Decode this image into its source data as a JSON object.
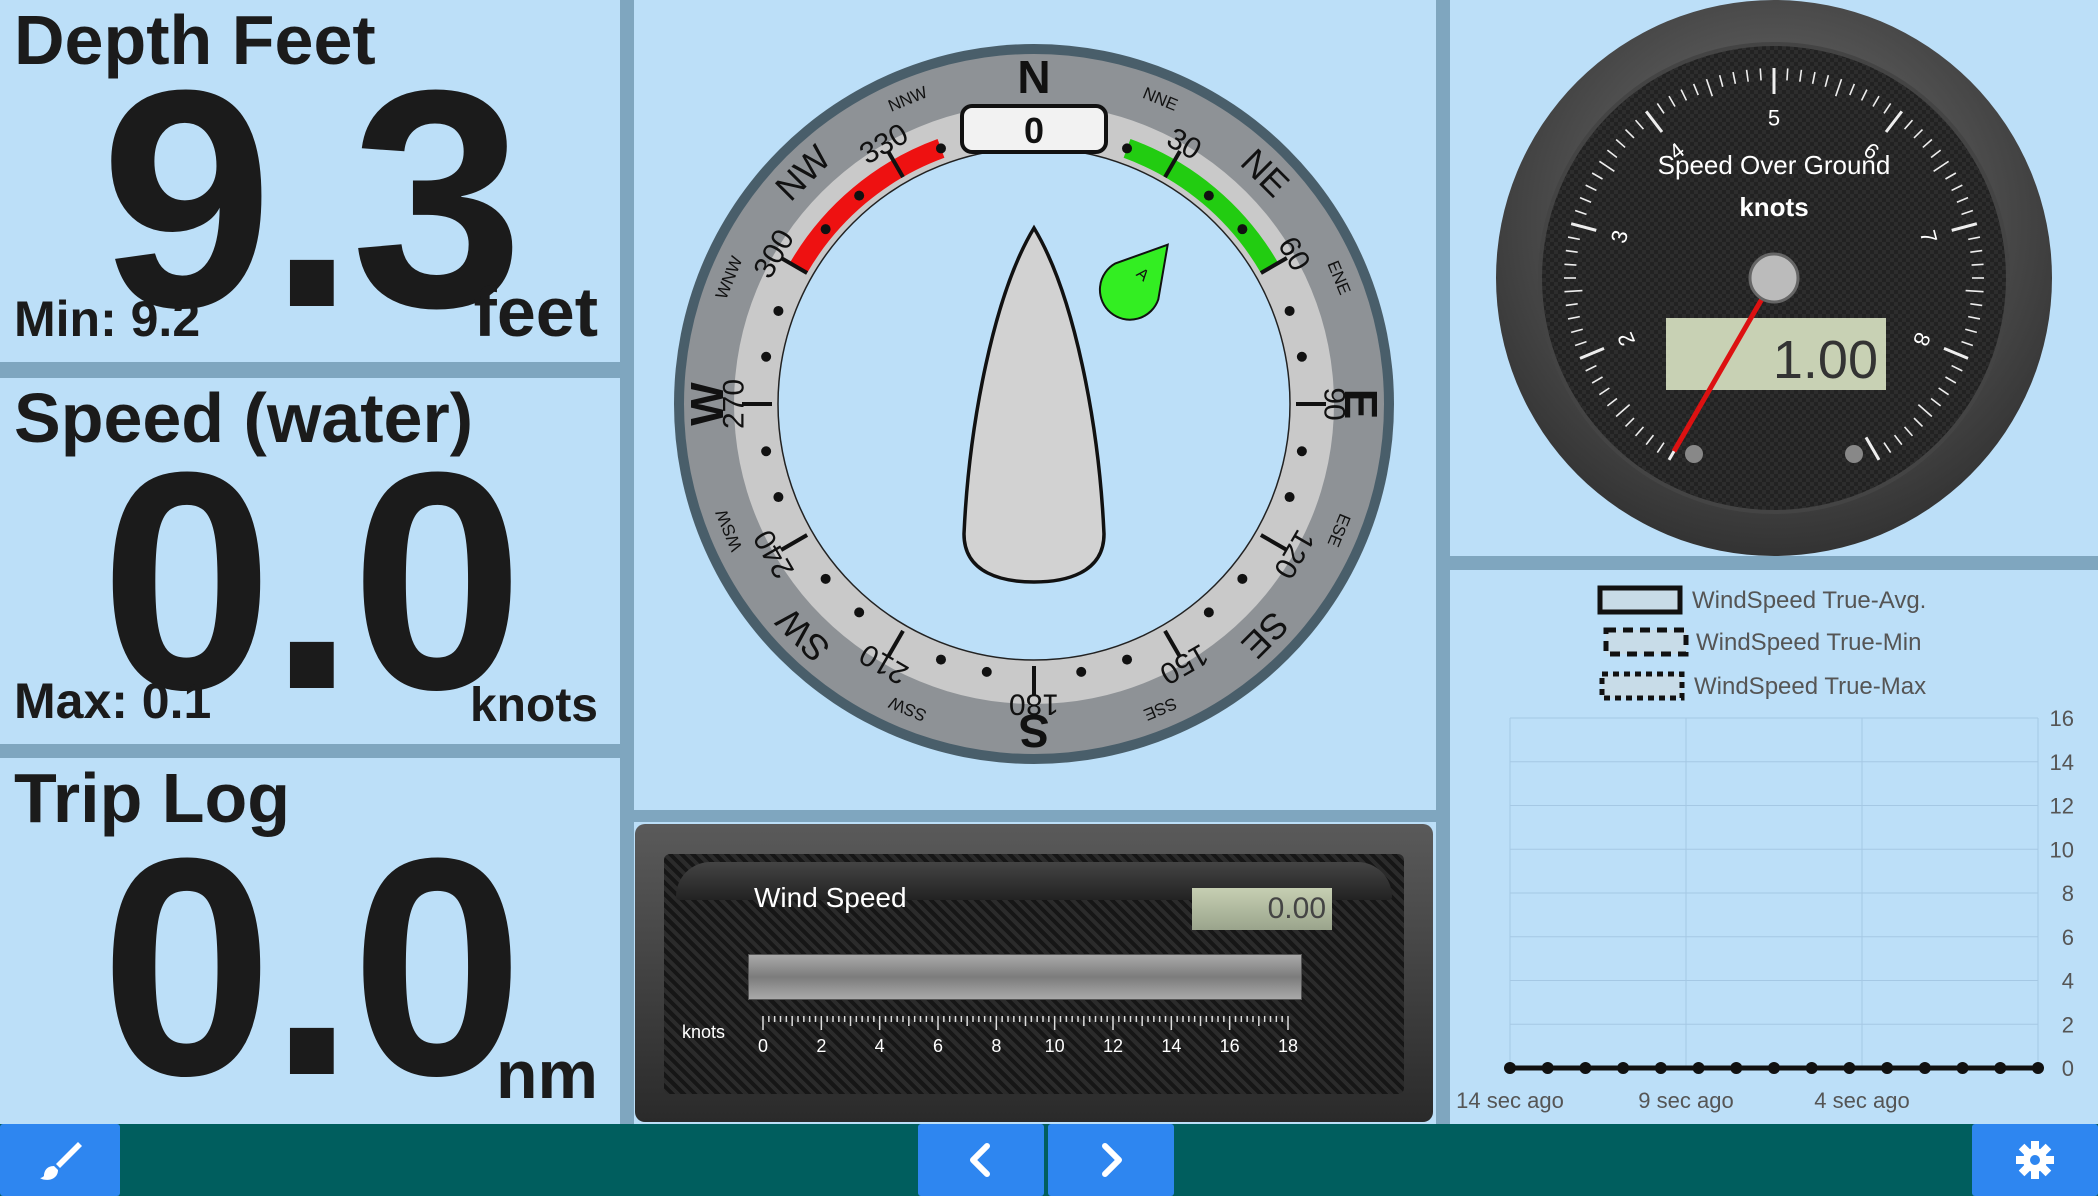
{
  "depth": {
    "title": "Depth Feet",
    "value": "9.3",
    "sub": "Min: 9.2",
    "unit": "feet"
  },
  "speed_water": {
    "title": "Speed (water)",
    "value": "0.0",
    "sub": "Max: 0.1",
    "unit": "knots"
  },
  "trip_log": {
    "title": "Trip Log",
    "value": "0.0",
    "unit": "nm"
  },
  "compass": {
    "heading": "0",
    "cardinals": {
      "n": "N",
      "e": "E",
      "s": "S",
      "w": "W"
    },
    "intercardinals": {
      "ne": "NE",
      "se": "SE",
      "sw": "SW",
      "nw": "NW"
    },
    "minor": {
      "nne": "NNE",
      "ene": "ENE",
      "ese": "ESE",
      "sse": "SSE",
      "ssw": "SSW",
      "wsw": "WSW",
      "wnw": "WNW",
      "nnw": "NNW"
    },
    "degree_labels": [
      "30",
      "60",
      "90",
      "120",
      "150",
      "180",
      "210",
      "240",
      "270",
      "300",
      "330"
    ],
    "wind_marker_label": "A",
    "colors": {
      "port": "#ee1111",
      "starboard": "#22cc11",
      "wind_marker": "#33ee22"
    }
  },
  "wind_speed": {
    "title": "Wind Speed",
    "value": "0.00",
    "unit": "knots",
    "scale": [
      "0",
      "2",
      "4",
      "6",
      "8",
      "10",
      "12",
      "14",
      "16",
      "18"
    ],
    "min": 0,
    "max": 18,
    "current": 0
  },
  "sog": {
    "title": "Speed Over Ground",
    "unit": "knots",
    "value": "1.00",
    "scale": [
      "2",
      "3",
      "4",
      "5",
      "6",
      "7",
      "8"
    ],
    "min": 1,
    "max": 9,
    "current": 1.0
  },
  "chart_data": {
    "type": "line",
    "series": [
      {
        "name": "WindSpeed True-Avg.",
        "values": [
          0,
          0,
          0,
          0,
          0,
          0,
          0,
          0,
          0,
          0,
          0,
          0,
          0,
          0,
          0
        ]
      },
      {
        "name": "WindSpeed True-Min",
        "values": [
          0,
          0,
          0,
          0,
          0,
          0,
          0,
          0,
          0,
          0,
          0,
          0,
          0,
          0,
          0
        ]
      },
      {
        "name": "WindSpeed True-Max",
        "values": [
          0,
          0,
          0,
          0,
          0,
          0,
          0,
          0,
          0,
          0,
          0,
          0,
          0,
          0,
          0
        ]
      }
    ],
    "x_labels": [
      "14 sec ago",
      "9 sec ago",
      "4 sec ago"
    ],
    "y_ticks": [
      "0",
      "2",
      "4",
      "6",
      "8",
      "10",
      "12",
      "14",
      "16"
    ],
    "ylim": [
      0,
      16
    ],
    "grid": true,
    "legend_position": "top"
  },
  "toolbar": {
    "theme_icon": "paintbrush-icon",
    "prev_icon": "chevron-left-icon",
    "next_icon": "chevron-right-icon",
    "settings_icon": "gear-icon",
    "button_color": "#2e86f0",
    "bar_color": "#005e5e"
  }
}
